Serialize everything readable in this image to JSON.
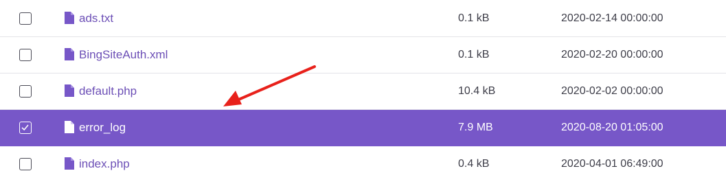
{
  "colors": {
    "accent": "#7757c8",
    "link": "#6c4fb6",
    "text": "#3d3d48",
    "arrow": "#e8211b"
  },
  "files": [
    {
      "name": "ads.txt",
      "size": "0.1 kB",
      "modified": "2020-02-14 00:00:00",
      "selected": false,
      "icon": "file-icon"
    },
    {
      "name": "BingSiteAuth.xml",
      "size": "0.1 kB",
      "modified": "2020-02-20 00:00:00",
      "selected": false,
      "icon": "file-icon"
    },
    {
      "name": "default.php",
      "size": "10.4 kB",
      "modified": "2020-02-02 00:00:00",
      "selected": false,
      "icon": "file-icon"
    },
    {
      "name": "error_log",
      "size": "7.9 MB",
      "modified": "2020-08-20 01:05:00",
      "selected": true,
      "icon": "file-icon"
    },
    {
      "name": "index.php",
      "size": "0.4 kB",
      "modified": "2020-04-01 06:49:00",
      "selected": false,
      "icon": "file-icon"
    }
  ]
}
